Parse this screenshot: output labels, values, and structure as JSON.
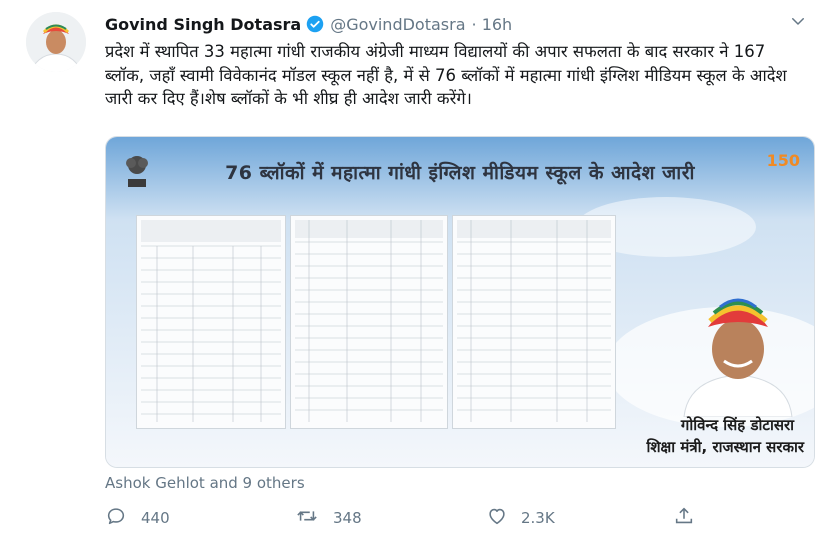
{
  "author": {
    "name": "Govind Singh Dotasra",
    "handle": "@GovindDotasra",
    "time": "· 16h"
  },
  "tweet": {
    "text": "प्रदेश में स्थापित 33 महात्मा गांधी राजकीय अंग्रेजी माध्यम विद्यालयों की अपार सफलता के बाद सरकार ने 167 ब्लॉक, जहाँ स्वामी विवेकानंद मॉडल स्कूल नहीं है, में से 76 ब्लॉकों में महात्मा गांधी इंग्लिश मीडियम स्कूल के आदेश जारी कर दिए हैं।शेष ब्लॉकों के भी शीघ्र ही आदेश जारी करेंगे।"
  },
  "media": {
    "banner_title": "76 ब्लॉकों में महात्मा गांधी इंग्लिश मीडियम स्कूल के आदेश जारी",
    "caption_name": "गोविन्द सिंह डोटासरा",
    "caption_role": "शिक्षा मंत्री, राजस्थान सरकार",
    "logo_text": "150"
  },
  "social_context": "Ashok Gehlot and 9 others",
  "stats": {
    "replies": "440",
    "retweets": "348",
    "likes": "2.3K"
  },
  "colors": {
    "name": "#14171a",
    "secondary": "#657786",
    "verified": "#1da1f2",
    "border": "#d7dee4"
  },
  "icons": [
    "verified-icon",
    "chevron-down-icon",
    "reply-icon",
    "retweet-icon",
    "like-icon",
    "share-icon"
  ]
}
